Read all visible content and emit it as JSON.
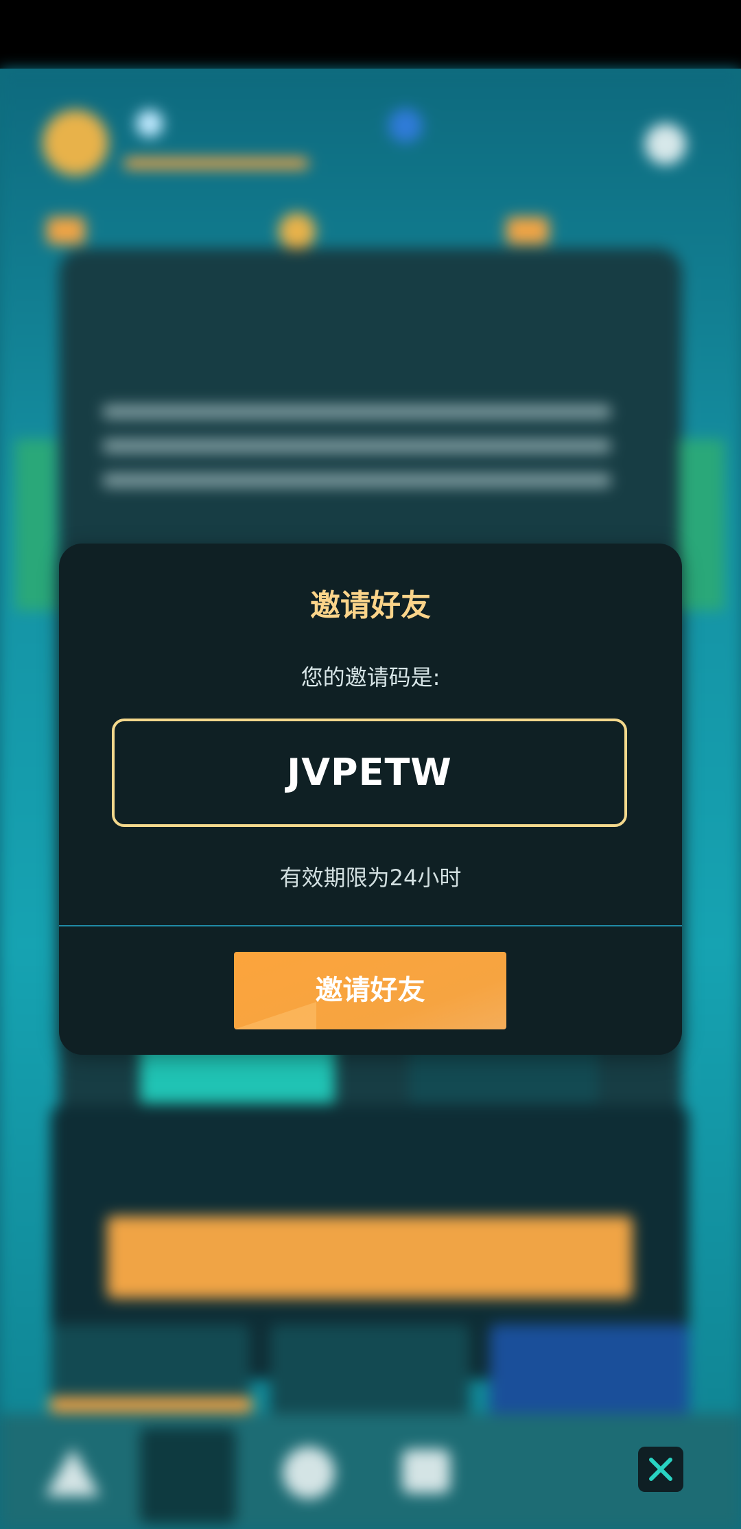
{
  "modal": {
    "title": "邀请好友",
    "code_label": "您的邀请码是:",
    "invite_code": "JVPETW",
    "validity": "有效期限为24小时",
    "invite_button": "邀请好友"
  },
  "close_button": {
    "icon": "close-icon"
  },
  "colors": {
    "modal_bg": "#0f2024",
    "title": "#fbd48a",
    "code_border": "#f3d88c",
    "button": "#fca43c",
    "divider": "#1f8aa6",
    "close_icon": "#29d3c2"
  }
}
